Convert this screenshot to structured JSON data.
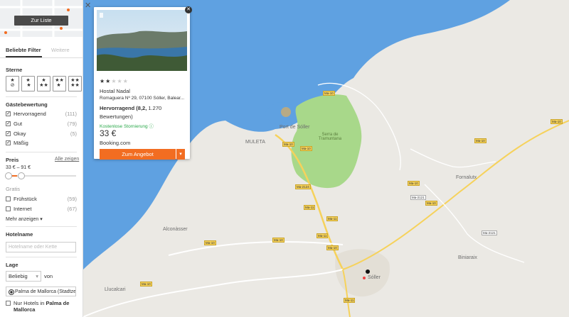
{
  "sidebar": {
    "list_button": "Zur Liste",
    "tabs": [
      "Beliebte Filter",
      "Weitere"
    ],
    "stars": {
      "title": "Sterne",
      "options": [
        "★\n⊘",
        "★\n ★",
        "★\n★★",
        "★★\n★ ",
        "★★\n★★"
      ]
    },
    "rating": {
      "title": "Gästebewertung",
      "items": [
        {
          "label": "Hervorragend",
          "count": "(111)"
        },
        {
          "label": "Gut",
          "count": "(79)"
        },
        {
          "label": "Okay",
          "count": "(5)"
        },
        {
          "label": "Mäßig",
          "count": ""
        }
      ]
    },
    "price": {
      "title": "Preis",
      "show_all": "Alle zeigen",
      "range": "33 € – 91 €"
    },
    "amenities": {
      "title": "Gratis",
      "items": [
        {
          "label": "Frühstück",
          "count": "(59)"
        },
        {
          "label": "Internet",
          "count": "(67)"
        }
      ],
      "more": "Mehr anzeigen ▾"
    },
    "hotelname": {
      "title": "Hotelname",
      "placeholder": "Hotelname oder Kette"
    },
    "location": {
      "title": "Lage",
      "select": "Beliebig",
      "from": "von",
      "place": "Palma de Mallorca (Stadtzentrum)",
      "only_label": "Nur Hotels in ",
      "only_bold": "Palma de Mallorca"
    }
  },
  "popup": {
    "stars": "★★★★★",
    "name": "Hostal Nadal",
    "address": "Romaguera Nº 29, 07100 Sóller, Balear...",
    "rating_label": "Hervorragend",
    "rating_value": "(8,2,",
    "reviews": "1.270 Bewertungen)",
    "cancellation": "Kostenlose Stornierung",
    "price": "33 €",
    "provider": "Booking.com",
    "cta": "Zum Angebot",
    "cta_menu": "▾"
  },
  "map": {
    "places": [
      "Port de Sóller",
      "Serra de Tramuntana",
      "MULETA",
      "Fornalutx",
      "Biniaraix",
      "Alconàsser",
      "Sóller",
      "Llucalcari"
    ],
    "roads": [
      "Ma-10",
      "Ma-2124",
      "Ma-11",
      "Ma-2121",
      "Ma-10",
      "Ma-10",
      "Ma-10",
      "Ma-10",
      "Ma-11",
      "Ma-10",
      "Ma-10",
      "Ma-11",
      "Ma-10",
      "Ma-2121",
      "Ma-10",
      "Ma-10",
      "Ma-11",
      "Ma-10"
    ]
  },
  "colors": {
    "accent": "#f26d21",
    "water": "#5fa1e1",
    "green": "#a8d88a"
  }
}
